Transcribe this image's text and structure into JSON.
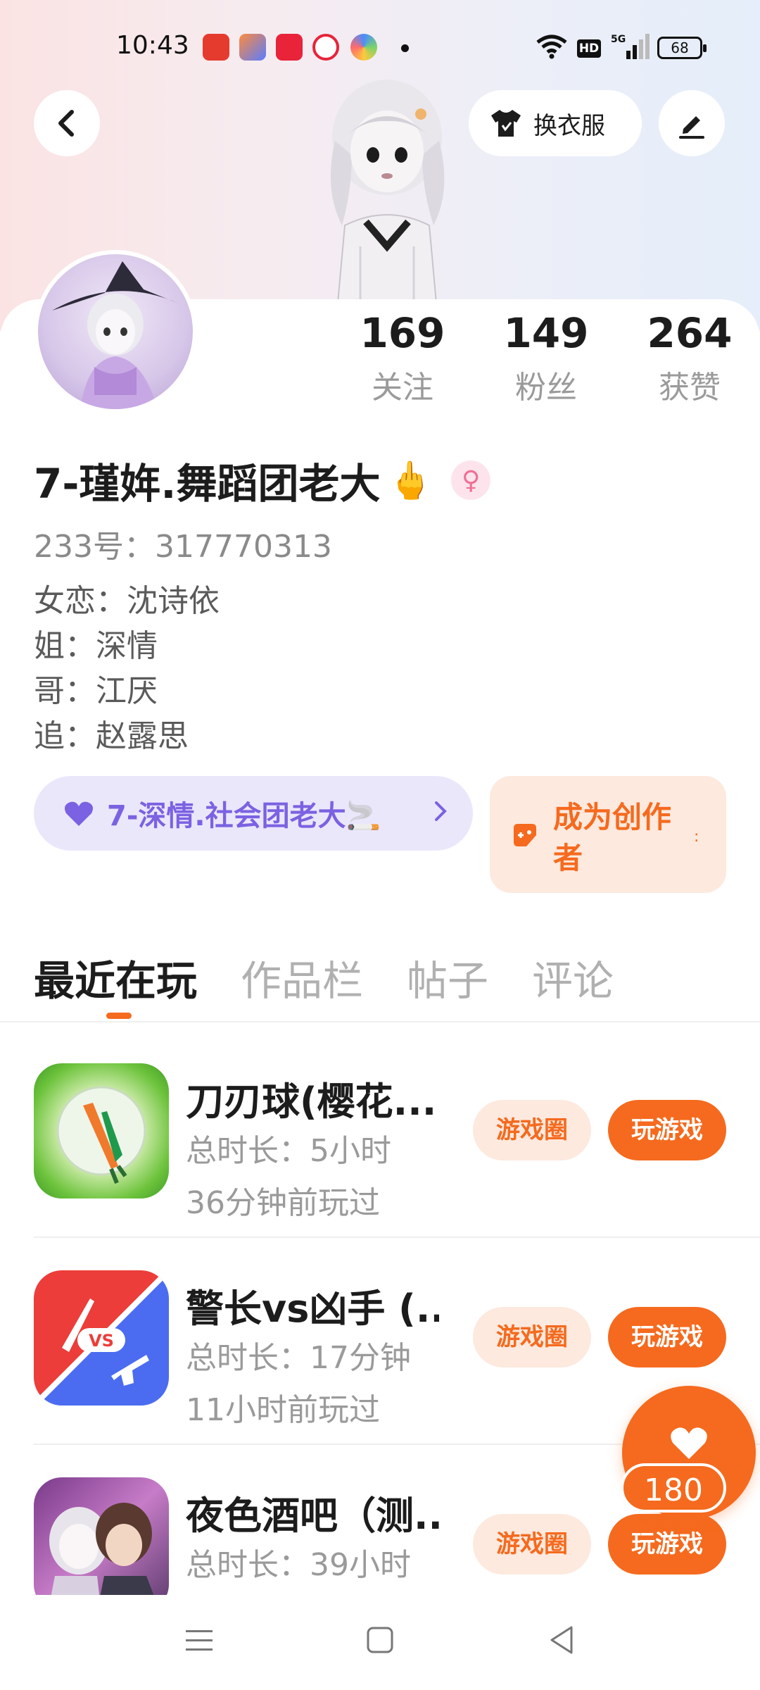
{
  "status_bar": {
    "time": "10:43",
    "battery": "68",
    "network": "HD"
  },
  "header": {
    "outfit_label": "换衣服"
  },
  "profile": {
    "stats": [
      {
        "value": "169",
        "label": "关注"
      },
      {
        "value": "149",
        "label": "粉丝"
      },
      {
        "value": "264",
        "label": "获赞"
      }
    ],
    "name": "7-瑾姩.舞蹈团老大",
    "name_emoji": "🖕",
    "gender_symbol": "♀",
    "uid": "233号：317770313",
    "bio": [
      "女恋：沈诗依",
      "姐：深情",
      "哥：江厌",
      "追：赵露思"
    ],
    "cp_label": "7-深情.社会团老大🚬",
    "creator_label": "成为创作者"
  },
  "tabs": [
    "最近在玩",
    "作品栏",
    "帖子",
    "评论"
  ],
  "games": [
    {
      "title": "刀刃球(樱花...",
      "duration": "总时长：5小时",
      "last_played": "36分钟前玩过",
      "circle_label": "游戏圈",
      "play_label": "玩游戏"
    },
    {
      "title": "警长vs凶手 (...",
      "duration": "总时长：17分钟",
      "last_played": "11小时前玩过",
      "circle_label": "游戏圈",
      "play_label": "玩游戏",
      "icon_text": "VS"
    },
    {
      "title": "夜色酒吧（测...",
      "duration": "总时长：39小时",
      "last_played": "",
      "circle_label": "游戏圈",
      "play_label": "玩游戏"
    }
  ],
  "fab": {
    "count": "180"
  },
  "colors": {
    "accent": "#f56a1e",
    "accent_light": "#fde9de",
    "cp_purple": "#7b62e2",
    "cp_bg": "#ebe7fb"
  }
}
